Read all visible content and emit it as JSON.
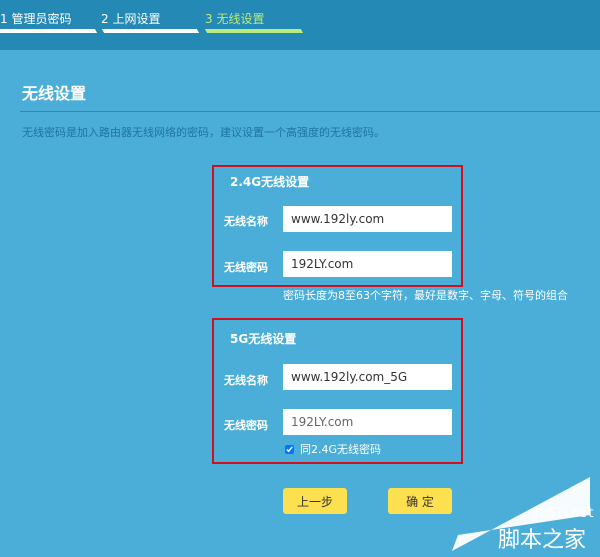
{
  "steps": [
    {
      "label": "1 管理员密码"
    },
    {
      "label": "2 上网设置"
    },
    {
      "label": "3 无线设置"
    }
  ],
  "colors": {
    "header": "#2589b5",
    "background": "#4aaed8",
    "active_step": "#b8ec7c",
    "highlight_border": "#d0101a",
    "button": "#fde04f"
  },
  "page": {
    "title": "无线设置",
    "description": "无线密码是加入路由器无线网络的密码，建议设置一个高强度的无线密码。"
  },
  "band24": {
    "title": "2.4G无线设置",
    "name_label": "无线名称",
    "name_value": "www.192ly.com",
    "pwd_label": "无线密码",
    "pwd_value": "192LY.com",
    "hint": "密码长度为8至63个字符，最好是数字、字母、符号的组合"
  },
  "band5": {
    "title": "5G无线设置",
    "name_label": "无线名称",
    "name_value": "www.192ly.com_5G",
    "pwd_label": "无线密码",
    "pwd_value": "192LY.com",
    "same_pwd_label": "同2.4G无线密码",
    "same_pwd_checked": true
  },
  "buttons": {
    "back": "上一步",
    "confirm": "确 定"
  },
  "watermark": {
    "site": "jb51.net",
    "name": "脚本之家"
  }
}
